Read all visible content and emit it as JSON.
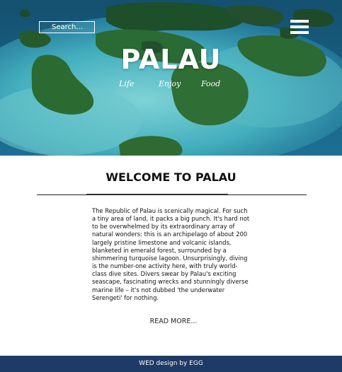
{
  "header": {
    "search_placeholder": "Search...",
    "title": "PALAU",
    "nav": [
      {
        "label": "Life"
      },
      {
        "label": "Enjoy"
      },
      {
        "label": "Food"
      }
    ],
    "menu_icon": "hamburger-icon"
  },
  "main": {
    "heading": "WELCOME TO PALAU",
    "intro": "The Republic of Palau is scenically magical. For such a tiny area of land, it packs a big punch. It's hard not to be overwhelmed by its extraordinary array of natural wonders: this is an archipelago of about 200 largely pristine limestone and volcanic islands, blanketed in emerald forest, surrounded by a shimmering turquoise lagoon. Unsurprisingly, diving is the number-one activity here, with truly world-class dive sites.  Divers swear by Palau's exciting seascape, fascinating wrecks and stunningly diverse marine life – it's not dubbed 'the underwater Serengeti' for nothing.",
    "read_more": "READ MORE..."
  },
  "footer": {
    "credit": "WED design by EGG"
  },
  "colors": {
    "footer_bg": "#1e3a66",
    "lagoon": "#3fa6b9",
    "island_green": "#1f5a2c"
  }
}
